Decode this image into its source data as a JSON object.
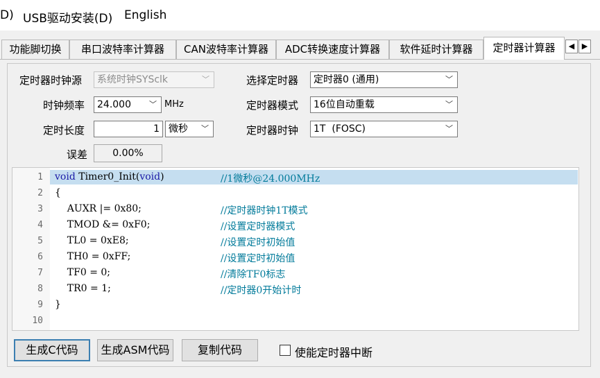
{
  "menubar": {
    "items": [
      "D)",
      "USB驱动安装(D)",
      "English"
    ]
  },
  "tabs": {
    "items": [
      "功能脚切换",
      "串口波特率计算器",
      "CAN波特率计算器",
      "ADC转换速度计算器",
      "软件延时计算器",
      "定时器计算器"
    ],
    "active": "定时器计算器",
    "scroll_left": "◀",
    "scroll_right": "▶"
  },
  "form": {
    "clock_source_label": "定时器时钟源",
    "clock_source_value": "系统时钟SYSclk",
    "clock_freq_label": "时钟频率",
    "clock_freq_value": "24.000",
    "clock_freq_unit": "MHz",
    "duration_label": "定时长度",
    "duration_value": "1",
    "duration_unit": "微秒",
    "error_label": "误差",
    "error_value": "0.00%",
    "select_timer_label": "选择定时器",
    "select_timer_value": "定时器0 (通用)",
    "timer_mode_label": "定时器模式",
    "timer_mode_value": "16位自动重载",
    "timer_clock_label": "定时器时钟",
    "timer_clock_value": "1T  (FOSC)"
  },
  "code": {
    "line_numbers": [
      "1",
      "2",
      "3",
      "4",
      "5",
      "6",
      "7",
      "8",
      "9",
      "10"
    ],
    "lines": [
      {
        "kw1": "void",
        "mid": " Timer0_Init(",
        "kw2": "void",
        "end": ")",
        "comment": "//1微秒@24.000MHz"
      },
      {
        "text": "{",
        "comment": ""
      },
      {
        "text": "    AUXR |= 0x80;",
        "comment": "//定时器时钟1T模式"
      },
      {
        "text": "    TMOD &= 0xF0;",
        "comment": "//设置定时器模式"
      },
      {
        "text": "    TL0 = 0xE8;",
        "comment": "//设置定时初始值"
      },
      {
        "text": "    TH0 = 0xFF;",
        "comment": "//设置定时初始值"
      },
      {
        "text": "    TF0 = 0;",
        "comment": "//清除TF0标志"
      },
      {
        "text": "    TR0 = 1;",
        "comment": "//定时器0开始计时"
      },
      {
        "text": "}",
        "comment": ""
      },
      {
        "text": "",
        "comment": ""
      }
    ]
  },
  "buttons": {
    "gen_c": "生成C代码",
    "gen_asm": "生成ASM代码",
    "copy": "复制代码",
    "enable_interrupt": "使能定时器中断"
  }
}
